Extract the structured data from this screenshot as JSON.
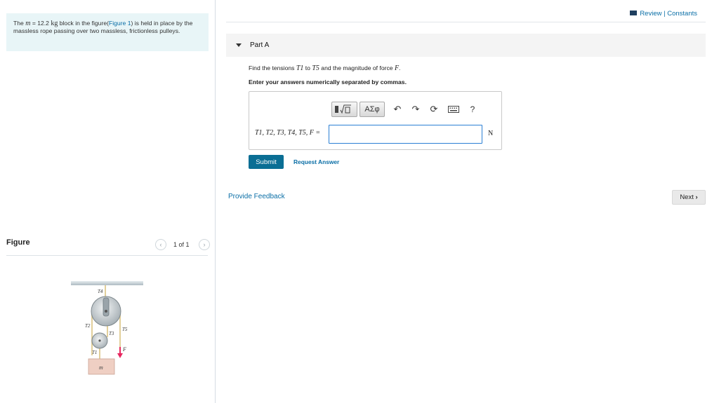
{
  "problem": {
    "prefix": "The ",
    "mass_symbol": "m",
    "mass_value": " = 12.2 ",
    "mass_unit": "kg",
    "middle": " block in the figure(",
    "figure_link": "Figure 1",
    "suffix": ") is held in place by the massless rope passing over two massless, frictionless pulleys."
  },
  "figure_panel": {
    "title": "Figure",
    "prev_icon": "chevron-left-icon",
    "next_icon": "chevron-right-icon",
    "count": "1 of 1",
    "labels": {
      "t4": "T4",
      "t2": "T2",
      "t3": "T3",
      "t5": "T5",
      "t1": "T1",
      "f": "F",
      "block": "m"
    }
  },
  "header": {
    "review": "Review",
    "separator": " | ",
    "constants": "Constants"
  },
  "part": {
    "title": "Part A"
  },
  "question": {
    "text_before": "Find the tensions ",
    "t1": "T1",
    "mid": " to ",
    "t5": "T5",
    "text_after": " and the magnitude of force ",
    "force": "F",
    "end": "."
  },
  "instruction": "Enter your answers numerically separated by commas.",
  "toolbar": {
    "templates_icon": "templates-icon",
    "greek_label": "ΑΣφ",
    "undo_icon": "undo-icon",
    "redo_icon": "redo-icon",
    "reset_icon": "reset-icon",
    "keyboard_icon": "keyboard-icon",
    "help_label": "?"
  },
  "answer": {
    "label": "T1, T2, T3, T4, T5, F =",
    "value": "",
    "unit": "N"
  },
  "buttons": {
    "submit": "Submit",
    "request_answer": "Request Answer",
    "provide_feedback": "Provide Feedback",
    "next": "Next"
  },
  "colors": {
    "accent": "#0a6ea6",
    "submit_bg": "#0a6e94",
    "problem_bg": "#e8f5f7",
    "arrow": "#e8265f"
  }
}
